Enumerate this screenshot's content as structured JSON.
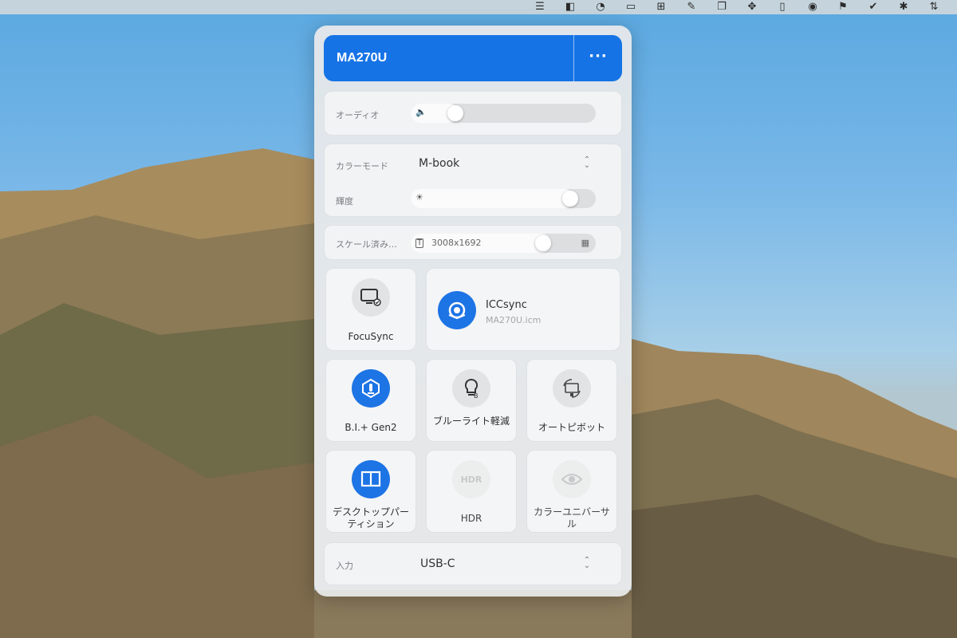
{
  "menubar": {
    "icons": [
      "control-center-icon",
      "app-icon",
      "clock-icon",
      "display-icon",
      "grid-icon",
      "brush-icon",
      "copy-icon",
      "cursor-icon",
      "tablet-icon",
      "disk-icon",
      "flag-icon",
      "check-icon",
      "bluetooth-icon",
      "arrows-icon"
    ]
  },
  "panel": {
    "title": "MA270U",
    "more_label": "···",
    "audio": {
      "label": "オーディオ",
      "level": 0.13
    },
    "color_mode": {
      "label": "カラーモード",
      "value": "M-book"
    },
    "brightness": {
      "label": "輝度",
      "level": 0.87
    },
    "scaling": {
      "label": "スケール済み…",
      "value": "3008x1692",
      "level": 0.72
    },
    "focusync": {
      "label": "FocuSync",
      "active": false
    },
    "iccsync": {
      "label": "ICCsync",
      "file": "MA270U.icm",
      "active": true
    },
    "bi_gen2": {
      "label": "B.I.+ Gen2",
      "active": true
    },
    "blue_light": {
      "label": "ブルーライト軽減",
      "active": false
    },
    "auto_pivot": {
      "label": "オートピボット",
      "active": false
    },
    "desktop_partition": {
      "label": "デスクトップパーティション",
      "active": true
    },
    "hdr": {
      "label": "HDR",
      "icon_text": "HDR",
      "enabled": false
    },
    "color_universal": {
      "label": "カラーユニバーサル",
      "enabled": false
    },
    "input": {
      "label": "入力",
      "value": "USB-C"
    }
  },
  "colors": {
    "accent": "#1673e6",
    "panel_bg": "#e8eaeb"
  }
}
